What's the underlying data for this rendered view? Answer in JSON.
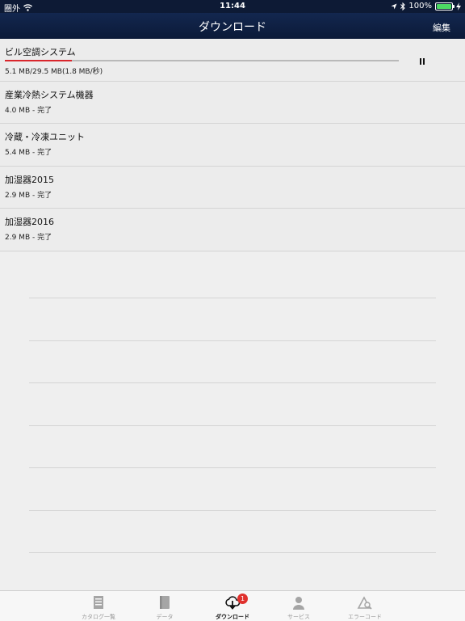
{
  "status_bar": {
    "carrier": "圏外",
    "time": "11:44",
    "battery": "100%",
    "icons": [
      "wifi-icon",
      "location-icon",
      "bluetooth-icon",
      "battery-icon",
      "charging-icon"
    ]
  },
  "nav": {
    "title": "ダウンロード",
    "edit_label": "編集"
  },
  "downloads": [
    {
      "title": "ビル空調システム",
      "status": "5.1 MB/29.5 MB(1.8 MB/秒)",
      "progress": 0.17,
      "state": "downloading"
    },
    {
      "title": "産業冷熱システム機器",
      "status": "4.0 MB - 完了",
      "state": "complete"
    },
    {
      "title": "冷蔵・冷凍ユニット",
      "status": "5.4 MB - 完了",
      "state": "complete"
    },
    {
      "title": "加湿器2015",
      "status": "2.9 MB - 完了",
      "state": "complete"
    },
    {
      "title": "加湿器2016",
      "status": "2.9 MB - 完了",
      "state": "complete"
    }
  ],
  "tabs": [
    {
      "label": "カタログ一覧",
      "icon": "catalog-list-icon"
    },
    {
      "label": "データ",
      "icon": "book-icon"
    },
    {
      "label": "ダウンロード",
      "icon": "cloud-download-icon",
      "badge": "1",
      "active": true
    },
    {
      "label": "サービス",
      "icon": "person-icon"
    },
    {
      "label": "エラーコード",
      "icon": "warning-search-icon"
    }
  ],
  "colors": {
    "nav_bg": "#0b1a38",
    "progress": "#d9262c",
    "badge": "#e0312d",
    "battery": "#4cd964"
  }
}
